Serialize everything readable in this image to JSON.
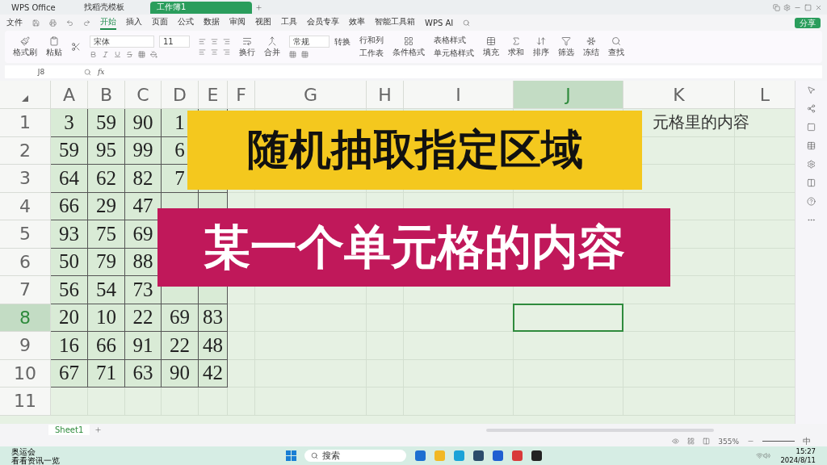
{
  "title_tabs": [
    {
      "label": "WPS Office",
      "selected": false
    },
    {
      "label": "找稻壳模板",
      "selected": false
    },
    {
      "label": "工作簿1",
      "selected": true
    }
  ],
  "menu": {
    "file": "文件",
    "tabs": [
      {
        "label": "开始",
        "selected": true
      },
      {
        "label": "插入",
        "selected": false
      },
      {
        "label": "页面",
        "selected": false
      },
      {
        "label": "公式",
        "selected": false
      },
      {
        "label": "数据",
        "selected": false
      },
      {
        "label": "审阅",
        "selected": false
      },
      {
        "label": "视图",
        "selected": false
      },
      {
        "label": "工具",
        "selected": false
      },
      {
        "label": "会员专享",
        "selected": false
      },
      {
        "label": "效率",
        "selected": false
      },
      {
        "label": "智能工具箱",
        "selected": false
      }
    ],
    "ai": "WPS AI",
    "share": "分享"
  },
  "ribbon": {
    "format_painter": "格式刷",
    "paste": "粘贴",
    "font": "宋体",
    "size": "11",
    "wrap": "换行",
    "merge": "合并",
    "number_format": "常规",
    "convert": "转换",
    "rows_cols": "行和列",
    "worksheet": "工作表",
    "cond_format": "条件格式",
    "table_style": "表格样式",
    "cell_style": "单元格样式",
    "tools": [
      "填充",
      "求和",
      "排序",
      "筛选",
      "冻结",
      "查找"
    ]
  },
  "formula_bar": {
    "name_box": "J8",
    "fx": "fx"
  },
  "sheet": {
    "columns": [
      {
        "label": "A",
        "selected": false
      },
      {
        "label": "B",
        "selected": false
      },
      {
        "label": "C",
        "selected": false
      },
      {
        "label": "D",
        "selected": false
      },
      {
        "label": "E",
        "selected": false
      },
      {
        "label": "F",
        "selected": false
      },
      {
        "label": "G",
        "selected": false
      },
      {
        "label": "H",
        "selected": false
      },
      {
        "label": "I",
        "selected": false
      },
      {
        "label": "J",
        "selected": true
      },
      {
        "label": "K",
        "selected": false
      },
      {
        "label": "L",
        "selected": false
      }
    ],
    "rows": [
      {
        "label": "1",
        "selected": false,
        "cells": [
          "3",
          "59",
          "90",
          "1",
          null,
          null,
          null,
          null,
          null,
          null,
          "元格里的内容",
          null
        ]
      },
      {
        "label": "2",
        "selected": false,
        "cells": [
          "59",
          "95",
          "99",
          "6",
          null,
          null,
          null,
          null,
          null,
          null,
          null,
          null
        ]
      },
      {
        "label": "3",
        "selected": false,
        "cells": [
          "64",
          "62",
          "82",
          "7",
          null,
          null,
          null,
          null,
          null,
          null,
          null,
          null
        ]
      },
      {
        "label": "4",
        "selected": false,
        "cells": [
          "66",
          "29",
          "47",
          null,
          null,
          null,
          null,
          null,
          null,
          null,
          null,
          null
        ]
      },
      {
        "label": "5",
        "selected": false,
        "cells": [
          "93",
          "75",
          "69",
          null,
          null,
          null,
          null,
          null,
          null,
          null,
          null,
          null
        ]
      },
      {
        "label": "6",
        "selected": false,
        "cells": [
          "50",
          "79",
          "88",
          null,
          null,
          null,
          null,
          null,
          null,
          null,
          null,
          null
        ]
      },
      {
        "label": "7",
        "selected": false,
        "cells": [
          "56",
          "54",
          "73",
          null,
          null,
          null,
          null,
          null,
          null,
          null,
          null,
          null
        ]
      },
      {
        "label": "8",
        "selected": true,
        "cells": [
          "20",
          "10",
          "22",
          "69",
          "83",
          null,
          null,
          null,
          null,
          null,
          null,
          null
        ]
      },
      {
        "label": "9",
        "selected": false,
        "cells": [
          "16",
          "66",
          "91",
          "22",
          "48",
          null,
          null,
          null,
          null,
          null,
          null,
          null
        ]
      },
      {
        "label": "10",
        "selected": false,
        "cells": [
          "67",
          "71",
          "63",
          "90",
          "42",
          null,
          null,
          null,
          null,
          null,
          null,
          null
        ]
      },
      {
        "label": "11",
        "selected": false,
        "cells": [
          null,
          null,
          null,
          null,
          null,
          null,
          null,
          null,
          null,
          null,
          null,
          null
        ]
      }
    ]
  },
  "overlays": [
    {
      "text": "随机抽取指定区域",
      "color": "#f4c81e"
    },
    {
      "text": "某一个单元格的内容",
      "color": "#c0185a"
    }
  ],
  "sheet_tabs": [
    {
      "label": "Sheet1",
      "selected": true
    }
  ],
  "status_bar": {
    "zoom": "355%",
    "ime": "中"
  },
  "taskbar": {
    "widget_title": "奥运会",
    "widget_subtitle": "看看资讯一览",
    "search": "搜索",
    "time": "15:27",
    "date": "2024/8/11"
  }
}
